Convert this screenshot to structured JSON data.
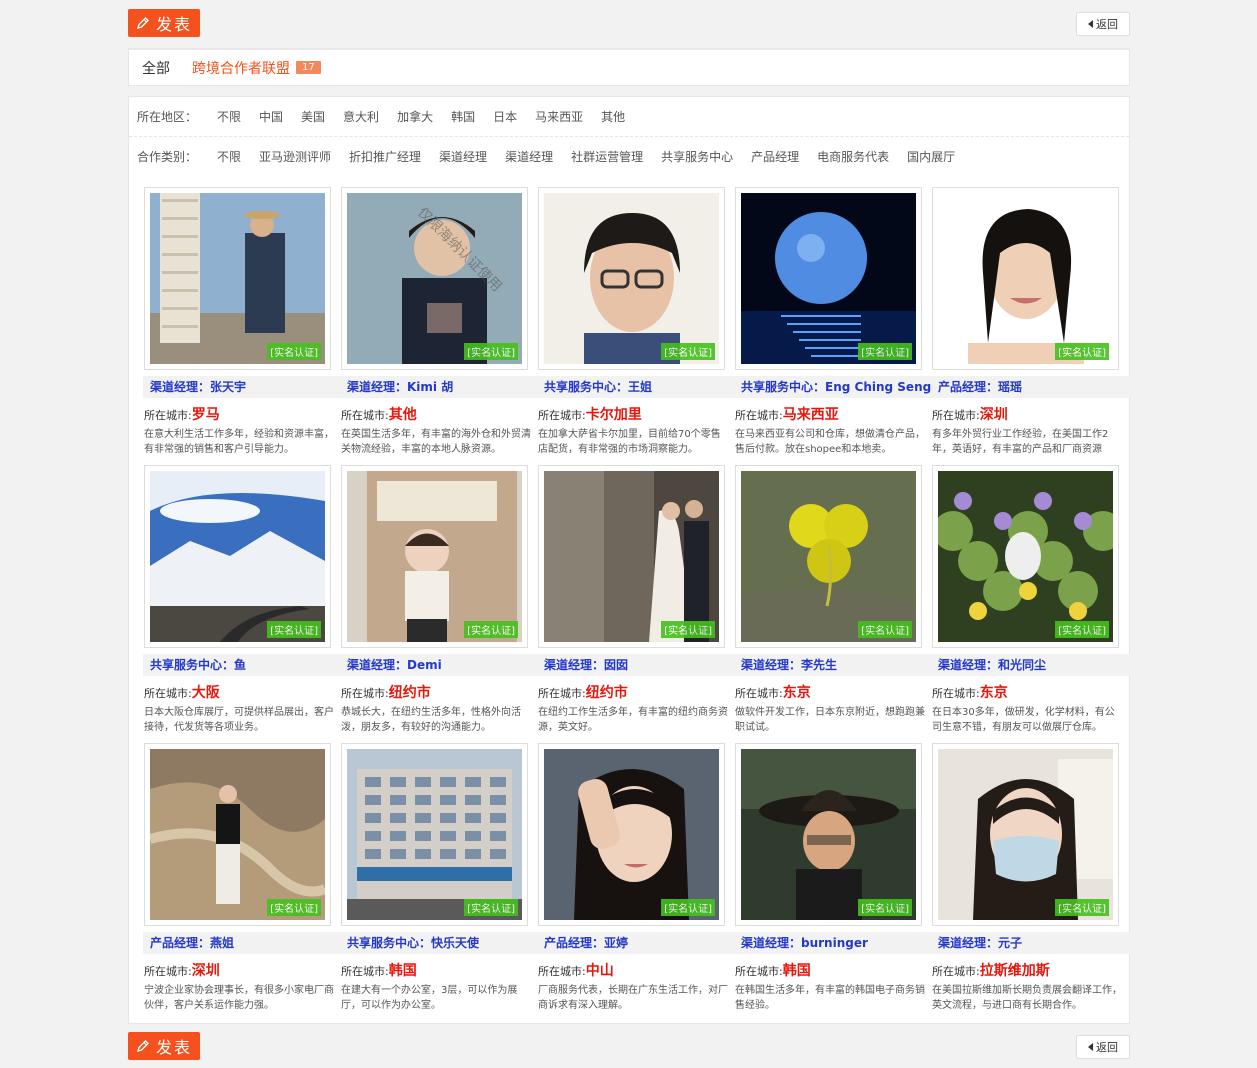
{
  "toolbar": {
    "post_label": "发表",
    "back_label": "返回"
  },
  "tabs": {
    "all_label": "全部",
    "active_label": "跨境合作者联盟",
    "active_count": "17"
  },
  "filters": {
    "region": {
      "label": "所在地区：",
      "options": [
        "不限",
        "中国",
        "美国",
        "意大利",
        "加拿大",
        "韩国",
        "日本",
        "马来西亚",
        "其他"
      ]
    },
    "category": {
      "label": "合作类别：",
      "options": [
        "不限",
        "亚马逊测评师",
        "折扣推广经理",
        "渠道经理",
        "渠道经理",
        "社群运营管理",
        "共享服务中心",
        "产品经理",
        "电商服务代表",
        "国内展厅"
      ]
    }
  },
  "badge_label": "[实名认证]",
  "city_label": "所在城市:",
  "watermark": "仅限海纳认证使用",
  "cards": [
    {
      "title": "渠道经理：张天宇",
      "city": "罗马",
      "desc": "在意大利生活工作多年，经验和资源丰富，有非常强的销售和客户引导能力。"
    },
    {
      "title": "渠道经理：Kimi 胡",
      "city": "其他",
      "desc": "在英国生活多年，有丰富的海外仓和外贸清关物流经验，丰富的本地人脉资源。"
    },
    {
      "title": "共享服务中心：王姐",
      "city": "卡尔加里",
      "desc": "在加拿大萨省卡尔加里，目前给70个零售店配货，有非常强的市场洞察能力。"
    },
    {
      "title": "共享服务中心：Eng Ching Seng",
      "city": "马来西亚",
      "desc": "在马来西亚有公司和仓库，想做清仓产品，售后付款。放在shopee和本地卖。"
    },
    {
      "title": "产品经理：瑶瑶",
      "city": "深圳",
      "desc": "有多年外贸行业工作经验，在美国工作2年，英语好，有丰富的产品和厂商资源"
    },
    {
      "title": "共享服务中心：鱼",
      "city": "大阪",
      "desc": "日本大阪仓库展厅，可提供样品展出，客户接待，代发货等各项业务。"
    },
    {
      "title": "渠道经理：Demi",
      "city": "纽约市",
      "desc": "恭城长大，在纽约生活多年，性格外向活泼，朋友多，有较好的沟通能力。"
    },
    {
      "title": "渠道经理：囡囡",
      "city": "纽约市",
      "desc": "在纽约工作生活多年，有丰富的纽约商务资源，英文好。"
    },
    {
      "title": "渠道经理：李先生",
      "city": "东京",
      "desc": "做软件开发工作，日本东京附近，想跑跑兼职试试。"
    },
    {
      "title": "渠道经理：和光同尘",
      "city": "东京",
      "desc": "在日本30多年，做研发，化学材料，有公司生意不错，有朋友可以做展厅仓库。"
    },
    {
      "title": "产品经理：燕姐",
      "city": "深圳",
      "desc": "宁波企业家协会理事长，有很多小家电厂商伙伴，客户关系运作能力强。"
    },
    {
      "title": "共享服务中心：快乐天使",
      "city": "韩国",
      "desc": "在建大有一个办公室，3层，可以作为展厅，可以作为办公室。"
    },
    {
      "title": "产品经理：亚婷",
      "city": "中山",
      "desc": "厂商服务代表，长期在广东生活工作，对厂商诉求有深入理解。"
    },
    {
      "title": "渠道经理：burninger",
      "city": "韩国",
      "desc": "在韩国生活多年，有丰富的韩国电子商务销售经验。"
    },
    {
      "title": "渠道经理：元子",
      "city": "拉斯维加斯",
      "desc": "在美国拉斯维加斯长期负责展会翻译工作，英文流程，与进口商有长期合作。"
    }
  ]
}
